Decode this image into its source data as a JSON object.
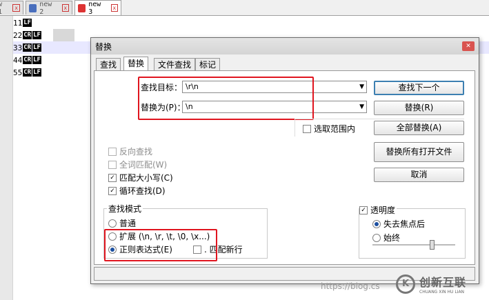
{
  "tabs": [
    {
      "label": "w 1"
    },
    {
      "label": "new 2"
    },
    {
      "label": "new 3"
    }
  ],
  "editor": {
    "lines": [
      {
        "num": "1",
        "text": "1",
        "eol": [
          "LF"
        ]
      },
      {
        "num": "2",
        "text": "2",
        "eol": [
          "CR",
          "LF"
        ]
      },
      {
        "num": "3",
        "text": "3",
        "eol": [
          "CR",
          "LF"
        ]
      },
      {
        "num": "4",
        "text": "4",
        "eol": [
          "CR",
          "LF"
        ]
      },
      {
        "num": "5",
        "text": "5",
        "eol": [
          "CR",
          "LF"
        ]
      }
    ]
  },
  "dialog": {
    "title": "替换",
    "tabs": [
      "查找",
      "替换",
      "文件查找",
      "标记"
    ],
    "find_label": "查找目标：",
    "find_value": "\\r\\n",
    "replace_label": "替换为(P)：",
    "replace_value": "\\n",
    "in_selection": "选取范围内",
    "buttons": {
      "find_next": "查找下一个",
      "replace": "替换(R)",
      "replace_all": "全部替换(A)",
      "replace_all_open": "替换所有打开文件",
      "cancel": "取消"
    },
    "options": {
      "backward": "反向查找",
      "whole_word": "全词匹配(W)",
      "match_case": "匹配大小写(C)",
      "wrap": "循环查找(D)"
    },
    "search_mode": {
      "title": "查找模式",
      "normal": "普通",
      "extended": "扩展 (\\n, \\r, \\t, \\0, \\x...)",
      "regex": "正则表达式(E)",
      "dot_newline": ". 匹配新行"
    },
    "transparency": {
      "title": "透明度",
      "on_lose_focus": "失去焦点后",
      "always": "始终",
      "level": 0.6
    }
  },
  "watermark": "https://blog.cs",
  "brand": {
    "cn": "创新互联",
    "en": "CHUANG XIN HU LIAN",
    "mark": "K"
  }
}
